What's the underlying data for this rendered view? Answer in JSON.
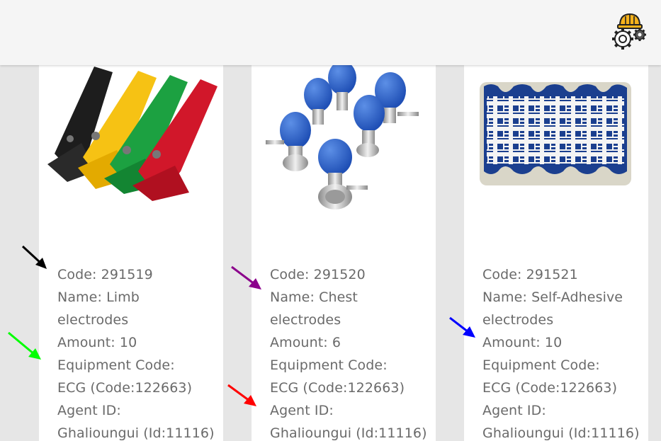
{
  "topbar": {
    "icon_name": "maintenance-engineer-gear-icon"
  },
  "cards": [
    {
      "image_icon": "limb-electrodes-image",
      "code": "Code: 291519",
      "name_line1": "Name: Limb",
      "name_line2": "electrodes",
      "amount": "Amount: 10",
      "equipment_label": "Equipment Code:",
      "equipment_value": "ECG (Code:122663)",
      "agent_label": "Agent ID:",
      "agent_value": "Ghalioungui (Id:11116)"
    },
    {
      "image_icon": "chest-electrodes-image",
      "code": "Code: 291520",
      "name_line1": "Name: Chest",
      "name_line2": "electrodes",
      "amount": "Amount: 6",
      "equipment_label": "Equipment Code:",
      "equipment_value": "ECG (Code:122663)",
      "agent_label": "Agent ID:",
      "agent_value": "Ghalioungui (Id:11116)"
    },
    {
      "image_icon": "self-adhesive-electrodes-image",
      "code": "Code: 291521",
      "name_line1": "Name: Self-Adhesive",
      "name_line2": "electrodes",
      "amount": "Amount: 10",
      "equipment_label": "Equipment Code:",
      "equipment_value": "ECG (Code:122663)",
      "agent_label": "Agent ID:",
      "agent_value": "Ghalioungui (Id:11116)"
    }
  ],
  "annotation_arrows": [
    {
      "name": "black-arrow",
      "color": "#000000"
    },
    {
      "name": "green-arrow",
      "color": "#00ff00"
    },
    {
      "name": "purple-arrow",
      "color": "#8b008b"
    },
    {
      "name": "red-arrow",
      "color": "#ff0000"
    },
    {
      "name": "blue-arrow",
      "color": "#0000ff"
    }
  ]
}
